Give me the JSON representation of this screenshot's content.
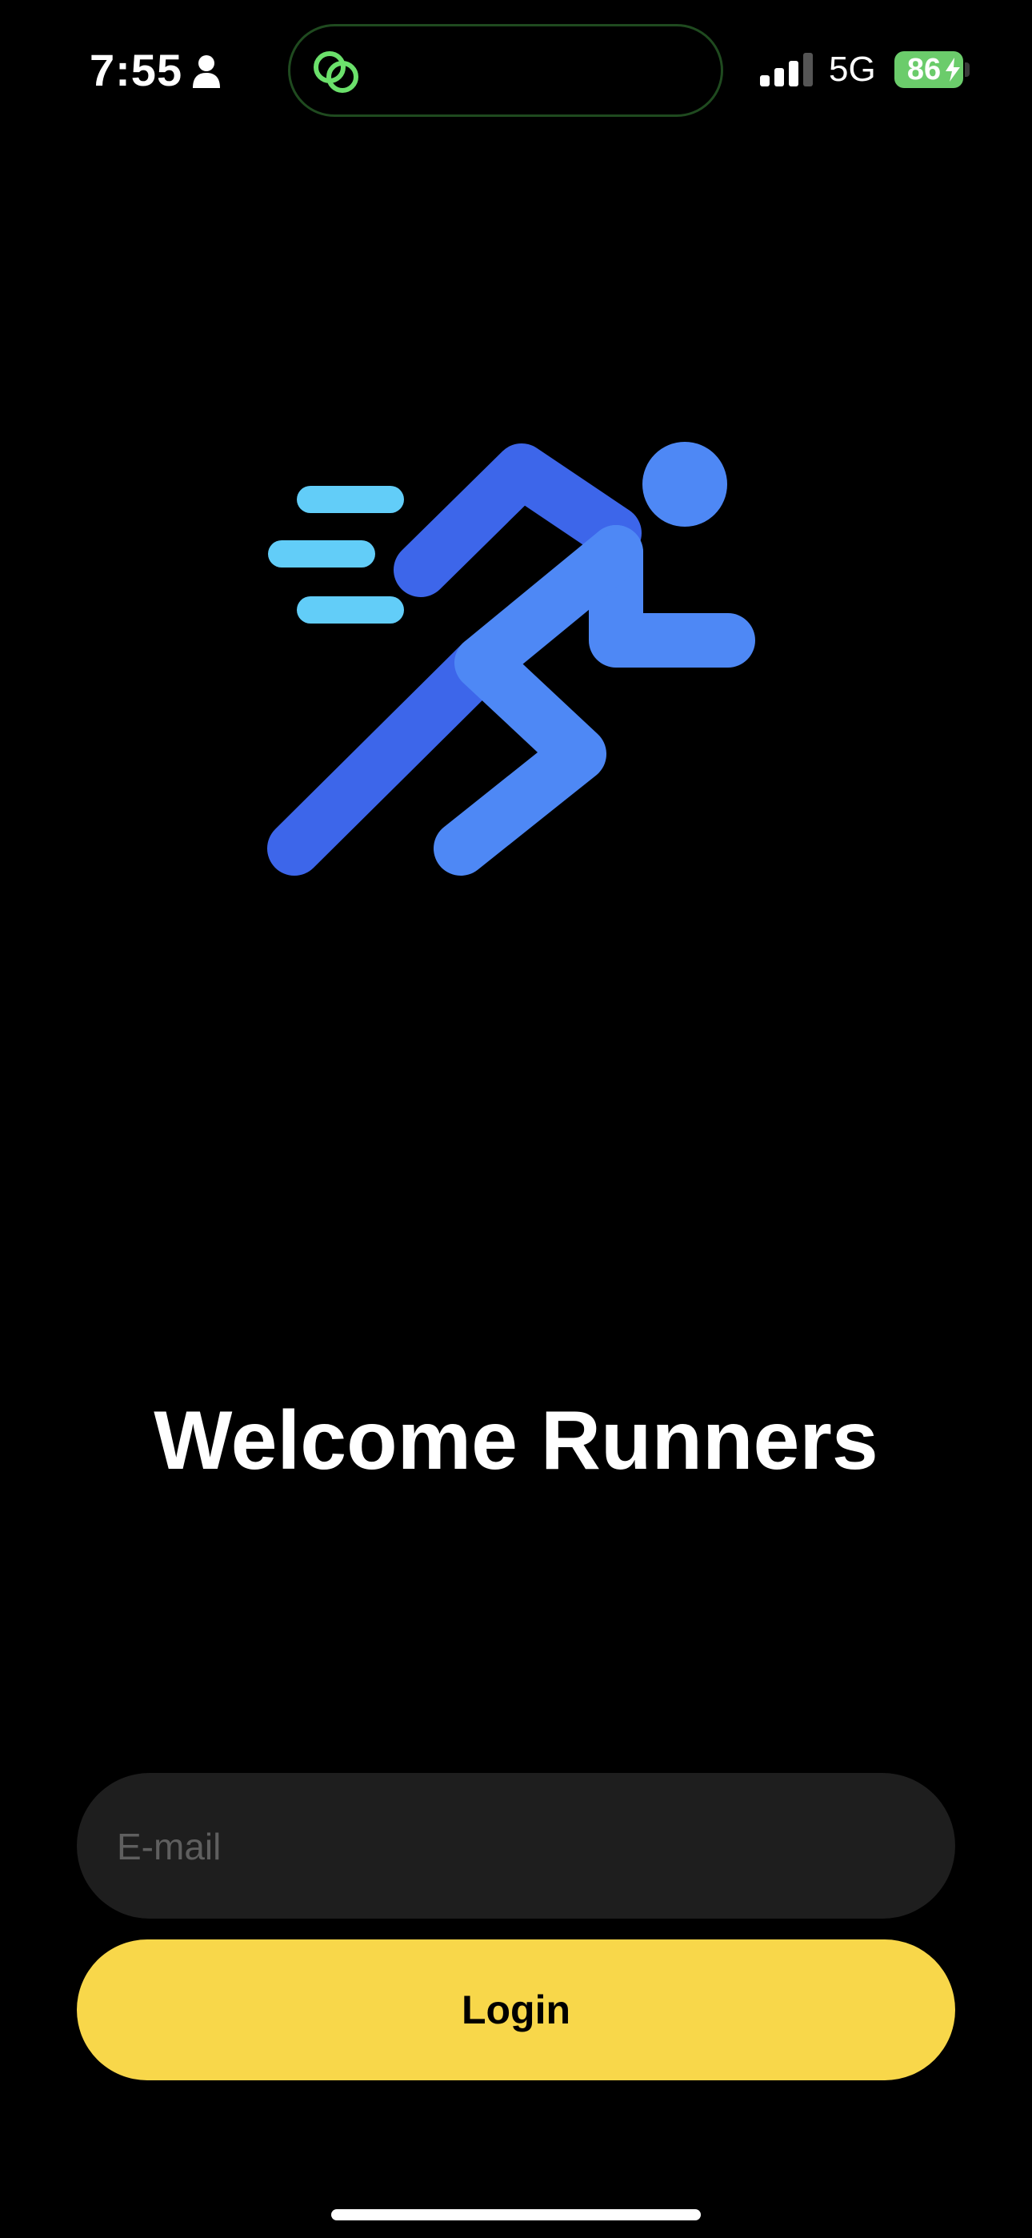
{
  "status_bar": {
    "time": "7:55",
    "network": "5G",
    "battery_level": "86"
  },
  "welcome": {
    "title": "Welcome Runners"
  },
  "login_form": {
    "email_placeholder": "E-mail",
    "email_value": "",
    "login_label": "Login"
  },
  "icons": [
    "person-icon",
    "dynamic-island-app-icon",
    "cellular-signal-icon",
    "battery-icon",
    "charging-bolt-icon",
    "runner-logo"
  ],
  "colors": {
    "background": "#000000",
    "accent_button": "#F8D74A",
    "input_background": "#1E1E1E",
    "runner_dark_blue": "#3D66EA",
    "runner_light_blue": "#4E88F5",
    "speed_lines": "#62CDF8",
    "battery_green": "#6BCC6B"
  }
}
